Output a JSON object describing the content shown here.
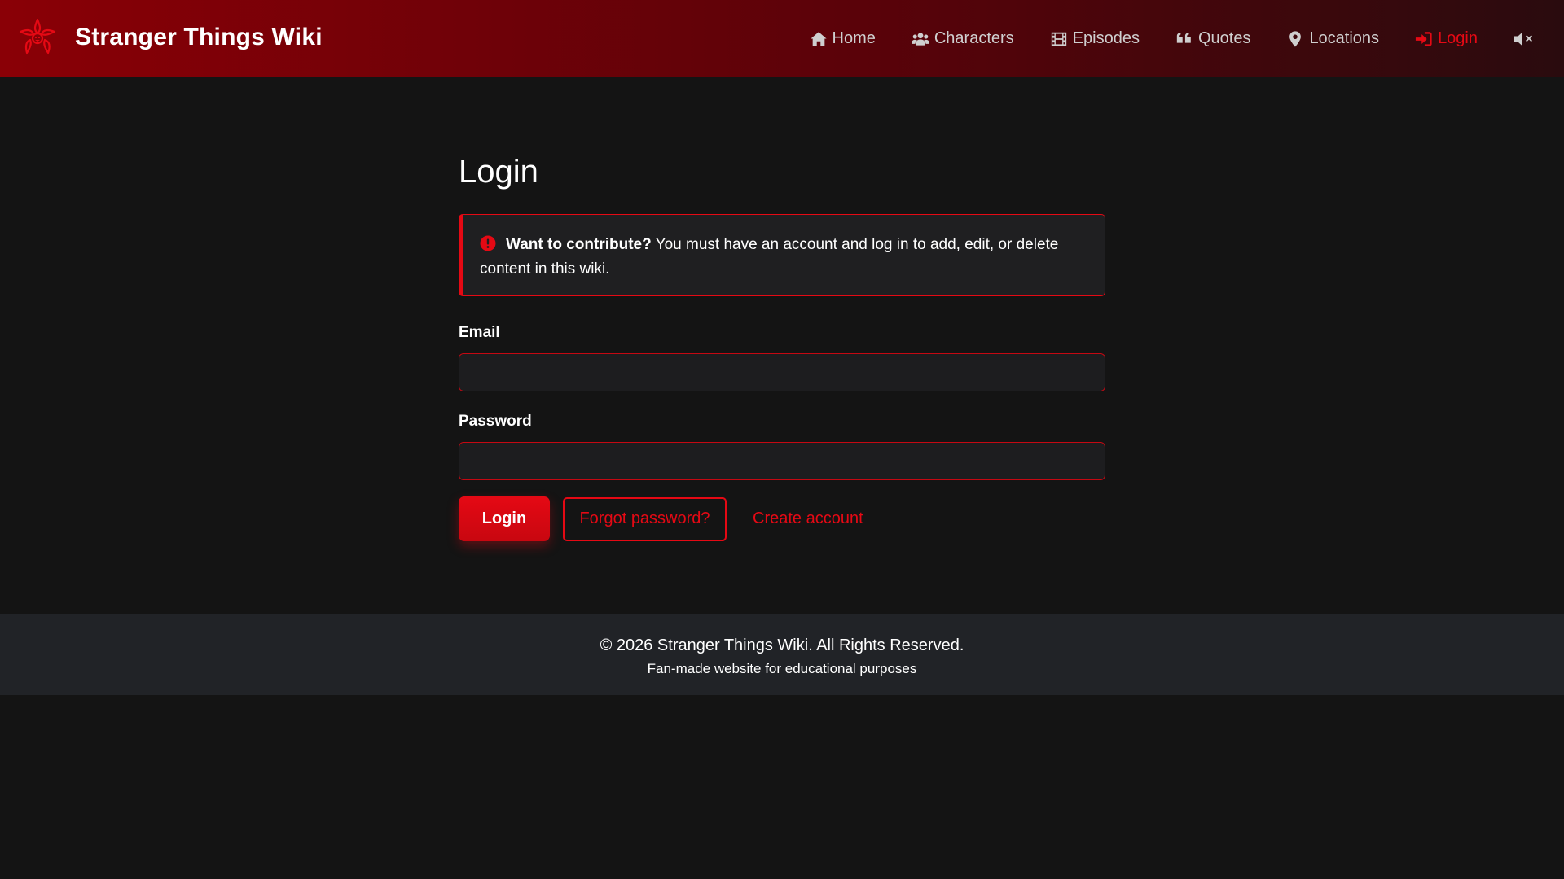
{
  "navbar": {
    "brand": "Stranger Things Wiki",
    "logo_icon": "demogorgon-logo-icon",
    "items": [
      {
        "label": "Home",
        "icon": "home-icon",
        "active": false
      },
      {
        "label": "Characters",
        "icon": "users-icon",
        "active": false
      },
      {
        "label": "Episodes",
        "icon": "film-icon",
        "active": false
      },
      {
        "label": "Quotes",
        "icon": "quote-icon",
        "active": false
      },
      {
        "label": "Locations",
        "icon": "map-pin-icon",
        "active": false
      },
      {
        "label": "Login",
        "icon": "sign-in-icon",
        "active": true
      }
    ],
    "mute_icon": "volume-mute-icon"
  },
  "page": {
    "title": "Login"
  },
  "alert": {
    "icon": "exclamation-circle-icon",
    "strong": "Want to contribute?",
    "text": " You must have an account and log in to add, edit, or delete content in this wiki."
  },
  "form": {
    "email_label": "Email",
    "email_value": "",
    "password_label": "Password",
    "password_value": "",
    "login_button": "Login",
    "forgot_button": "Forgot password?",
    "create_link": "Create account"
  },
  "footer": {
    "copyright": "© 2026 Stranger Things Wiki. All Rights Reserved.",
    "subtitle": "Fan-made website for educational purposes"
  },
  "colors": {
    "accent": "#e50914",
    "background": "#141414",
    "nav_gradient_start": "#8a0006",
    "footer_bg": "#212327"
  }
}
